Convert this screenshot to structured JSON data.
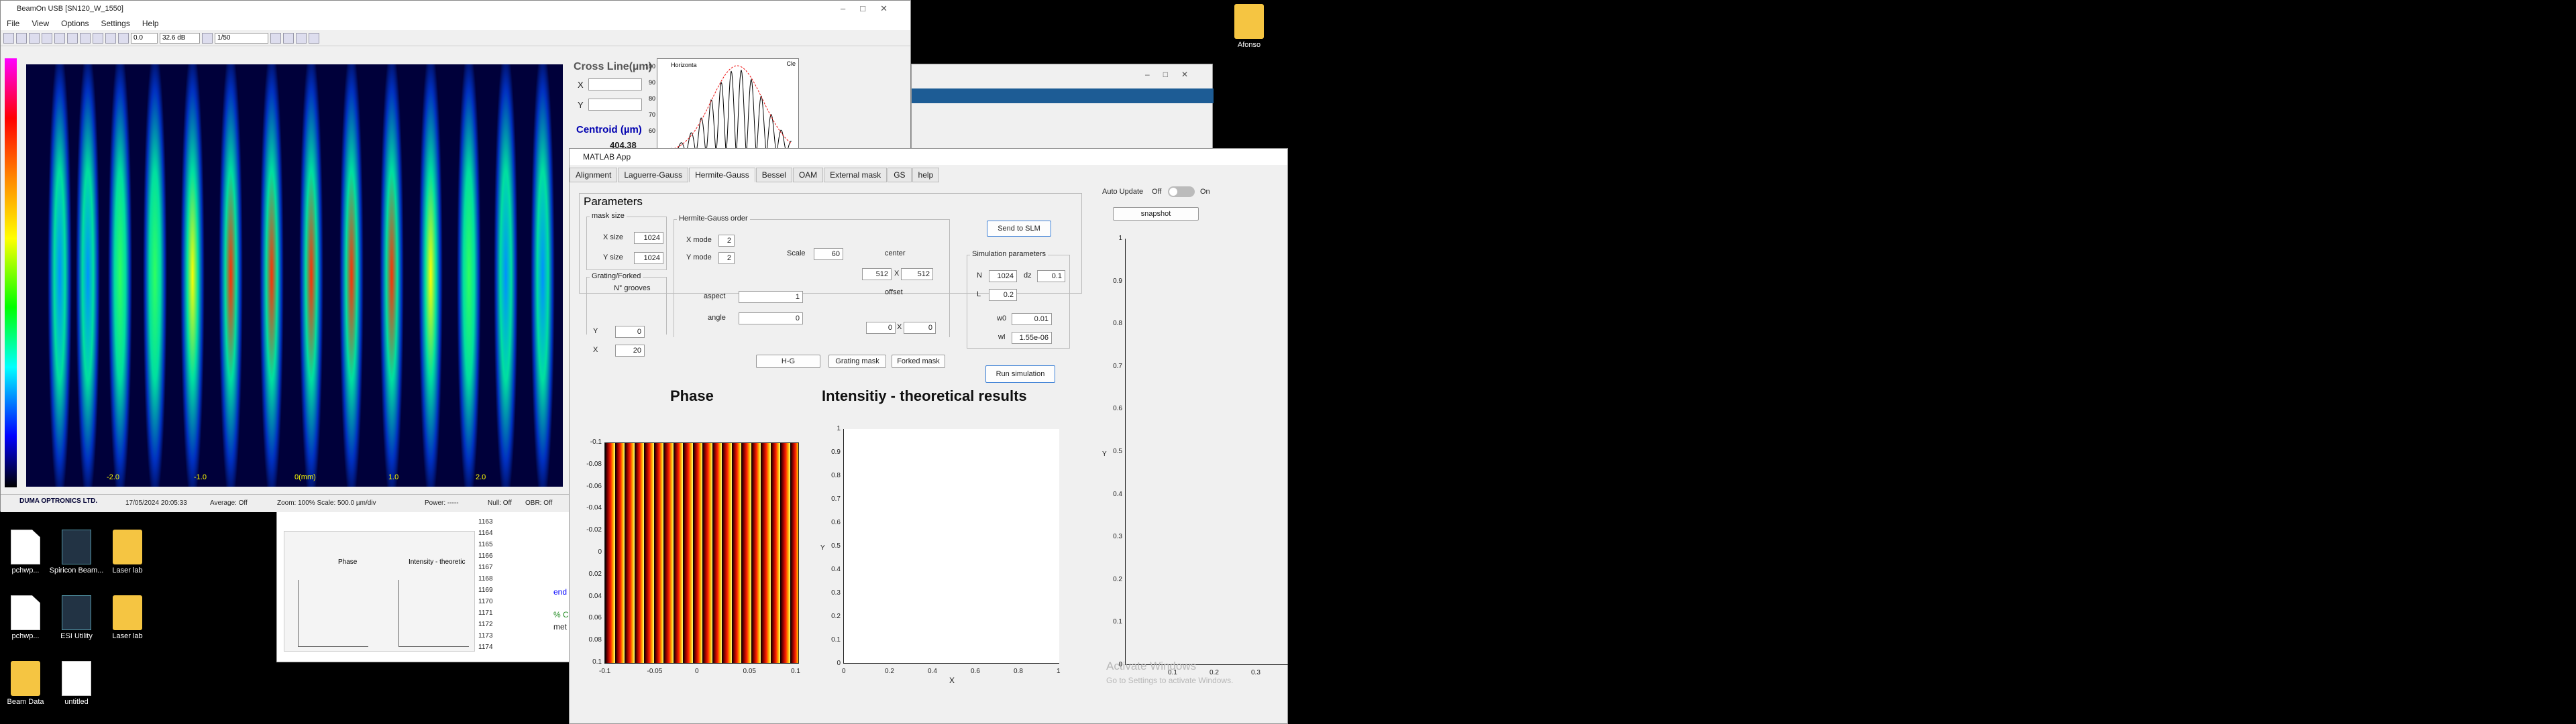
{
  "desktop": {
    "icons": [
      {
        "label": "Afonso"
      },
      {
        "label": "pchwp..."
      },
      {
        "label": "Spiricon Beam..."
      },
      {
        "label": "Laser lab"
      },
      {
        "label": "pchwp..."
      },
      {
        "label": "ESI Utility"
      },
      {
        "label": "Laser lab"
      },
      {
        "label": "Beam Data"
      },
      {
        "label": "untitled"
      }
    ]
  },
  "beam": {
    "title": "BeamOn USB [SN120_W_1550]",
    "menu": [
      "File",
      "View",
      "Options",
      "Settings",
      "Help"
    ],
    "toolbar": {
      "field1": "0.0",
      "field2": "32.6 dB",
      "field3": "1/50"
    },
    "x_ticks": [
      "-2.0",
      "-1.0",
      "0(mm)",
      "1.0",
      "2.0"
    ],
    "cross_line": "Cross Line(µm)",
    "x_label": "X",
    "y_label": "Y",
    "centroid": "Centroid (µm)",
    "centroid_value": "404.38",
    "plot_title": "Horizonta",
    "plot_yticks": [
      "100",
      "90",
      "80",
      "70",
      "60"
    ],
    "plot_ylabel": "[%]",
    "plot_right": "Cle",
    "status": {
      "brand": "DUMA OPTRONICS LTD.",
      "date": "17/05/2024 20:05:33",
      "average": "Average: Off",
      "zoom": "Zoom: 100%  Scale: 500.0 µm/div",
      "power": "Power:  -----",
      "null": "Null: Off",
      "obr": "OBR: Off"
    }
  },
  "editor": {
    "lines": [
      "1163",
      "1164",
      "1165",
      "1166",
      "1167",
      "1168",
      "1169",
      "1170",
      "1171",
      "1172",
      "1173",
      "1174"
    ],
    "preview_phase": "Phase",
    "preview_intensity": "Intensity - theoretic",
    "code1": "end",
    "code2": "% C",
    "code3": "met"
  },
  "app": {
    "title": "MATLAB App",
    "tabs": [
      "Alignment",
      "Laguerre-Gauss",
      "Hermite-Gauss",
      "Bessel",
      "OAM",
      "External mask",
      "GS",
      "help"
    ],
    "active_tab": "Hermite-Gauss",
    "parameters_title": "Parameters",
    "mask_size": {
      "title": "mask size",
      "x_label": "X size",
      "x_value": "1024",
      "y_label": "Y size",
      "y_value": "1024"
    },
    "grating": {
      "title": "Grating/Forked",
      "grooves": "N° grooves",
      "y_label": "Y",
      "y_value": "0",
      "x_label": "X",
      "x_value": "20"
    },
    "hg_order": {
      "title": "Hermite-Gauss order",
      "xmode_label": "X mode",
      "xmode": "2",
      "ymode_label": "Y mode",
      "ymode": "2",
      "scale_label": "Scale",
      "scale": "60",
      "center_label": "center",
      "cx": "512",
      "cy": "512",
      "x_sep": "X",
      "aspect_label": "aspect",
      "aspect": "1",
      "angle_label": "angle",
      "angle": "0",
      "offset_label": "offset",
      "ox": "0",
      "oy": "0"
    },
    "buttons": {
      "hg": "H-G",
      "grating_mask": "Grating mask",
      "forked_mask": "Forked mask",
      "send": "Send to SLM",
      "run": "Run simulation",
      "snapshot": "snapshot"
    },
    "sim": {
      "title": "Simulation parameters",
      "n_label": "N",
      "n": "1024",
      "dz_label": "dz",
      "dz": "0.1",
      "l_label": "L",
      "l": "0.2",
      "w0_label": "w0",
      "w0": "0.01",
      "wl_label": "wl",
      "wl": "1.55e-06"
    },
    "auto_update": "Auto Update",
    "off": "Off",
    "on": "On",
    "phase_title": "Phase",
    "intensity_title": "Intensitiy - theoretical results",
    "phase_yticks": [
      "-0.1",
      "-0.08",
      "-0.06",
      "-0.04",
      "-0.02",
      "0",
      "0.02",
      "0.04",
      "0.06",
      "0.08",
      "0.1"
    ],
    "phase_xticks": [
      "-0.1",
      "-0.05",
      "0",
      "0.05",
      "0.1"
    ],
    "int_yticks": [
      "1",
      "0.9",
      "0.8",
      "0.7",
      "0.6",
      "0.5",
      "0.4",
      "0.3",
      "0.2",
      "0.1",
      "0"
    ],
    "int_xticks": [
      "0",
      "0.2",
      "0.4",
      "0.6",
      "0.8",
      "1"
    ],
    "int_xlabel": "X",
    "int_ylabel": "Y",
    "big_yticks": [
      "1",
      "0.9",
      "0.8",
      "0.7",
      "0.6",
      "0.5",
      "0.4",
      "0.3",
      "0.2",
      "0.1",
      "0"
    ],
    "big_xticks": [
      "0.1",
      "0.2",
      "0.3"
    ],
    "big_ylabel": "Y",
    "watermark1": "Activate Windows",
    "watermark2": "Go to Settings to activate Windows."
  }
}
